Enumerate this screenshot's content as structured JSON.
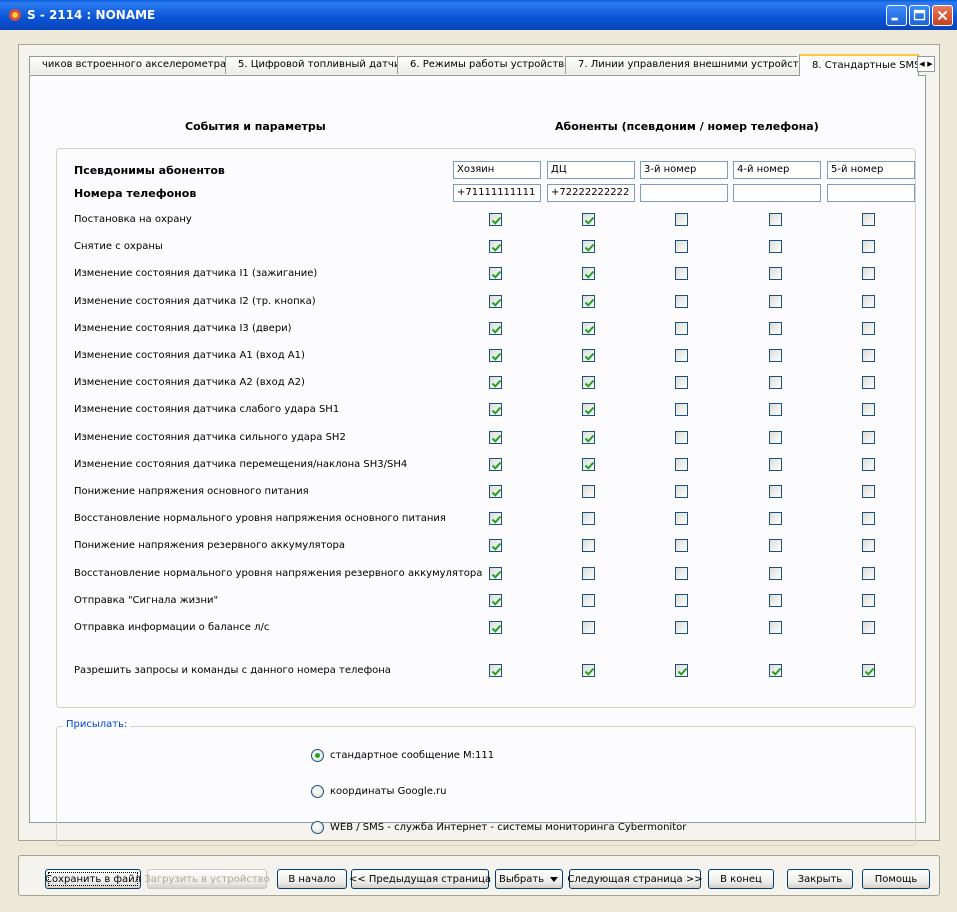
{
  "window": {
    "title": "S - 2114 : NONAME"
  },
  "tabs": [
    {
      "label": "чиков встроенного акселерометра"
    },
    {
      "label": "5. Цифровой топливный датчик"
    },
    {
      "label": "6. Режимы работы устройства"
    },
    {
      "label": "7. Линии управления внешними устройствами"
    },
    {
      "label": "8. Стандартные SMS"
    }
  ],
  "headers": {
    "events": "События и параметры",
    "subscribers": "Абоненты (псевдоним / номер телефона)"
  },
  "aliases_label": "Псевдонимы абонентов",
  "phones_label": "Номера телефонов",
  "aliases": [
    "Хозяин",
    "ДЦ",
    "3-й номер",
    "4-й номер",
    "5-й номер"
  ],
  "phones": [
    "+71111111111",
    "+72222222222",
    "",
    "",
    ""
  ],
  "events": [
    {
      "label": "Постановка на охрану",
      "checks": [
        true,
        true,
        false,
        false,
        false
      ]
    },
    {
      "label": "Снятие с охраны",
      "checks": [
        true,
        true,
        false,
        false,
        false
      ]
    },
    {
      "label": "Изменение состояния датчика I1 (зажигание)",
      "checks": [
        true,
        true,
        false,
        false,
        false
      ]
    },
    {
      "label": "Изменение состояния датчика I2 (тр. кнопка)",
      "checks": [
        true,
        true,
        false,
        false,
        false
      ]
    },
    {
      "label": "Изменение состояния датчика I3 (двери)",
      "checks": [
        true,
        true,
        false,
        false,
        false
      ]
    },
    {
      "label": "Изменение состояния датчика A1 (вход A1)",
      "checks": [
        true,
        true,
        false,
        false,
        false
      ]
    },
    {
      "label": "Изменение состояния датчика A2 (вход A2)",
      "checks": [
        true,
        true,
        false,
        false,
        false
      ]
    },
    {
      "label": "Изменение состояния датчика слабого удара SH1",
      "checks": [
        true,
        true,
        false,
        false,
        false
      ]
    },
    {
      "label": "Изменение состояния датчика сильного удара SH2",
      "checks": [
        true,
        true,
        false,
        false,
        false
      ]
    },
    {
      "label": "Изменение состояния датчика перемещения/наклона SH3/SH4",
      "checks": [
        true,
        true,
        false,
        false,
        false
      ]
    },
    {
      "label": "Понижение напряжения основного питания",
      "checks": [
        true,
        false,
        false,
        false,
        false
      ]
    },
    {
      "label": "Восстановление нормального уровня напряжения основного питания",
      "checks": [
        true,
        false,
        false,
        false,
        false
      ]
    },
    {
      "label": "Понижение напряжения резервного аккумулятора",
      "checks": [
        true,
        false,
        false,
        false,
        false
      ]
    },
    {
      "label": "Восстановление нормального уровня напряжения резервного аккумулятора",
      "checks": [
        true,
        false,
        false,
        false,
        false
      ]
    },
    {
      "label": "Отправка \"Сигнала жизни\"",
      "checks": [
        true,
        false,
        false,
        false,
        false
      ]
    },
    {
      "label": "Отправка информации о балансе л/с",
      "checks": [
        true,
        false,
        false,
        false,
        false
      ]
    }
  ],
  "allow_row": {
    "label": "Разрешить запросы и команды с данного номера телефона",
    "checks": [
      true,
      true,
      true,
      true,
      true
    ]
  },
  "send": {
    "legend": "Присылать:",
    "options": [
      {
        "label": "стандартное сообщение M:111",
        "selected": true
      },
      {
        "label": "координаты  Google.ru",
        "selected": false
      },
      {
        "label": "WEB / SMS - служба Интернет - системы мониторинга  Cybermonitor",
        "selected": false
      }
    ]
  },
  "buttons": {
    "save": "Сохранить в файл",
    "load": "Загрузить в устройство",
    "start": "В начало",
    "prev": "<< Предыдущая страница",
    "select": "Выбрать",
    "next": "Следующая страница  >>",
    "end": "В конец",
    "close": "Закрыть",
    "help": "Помощь"
  }
}
